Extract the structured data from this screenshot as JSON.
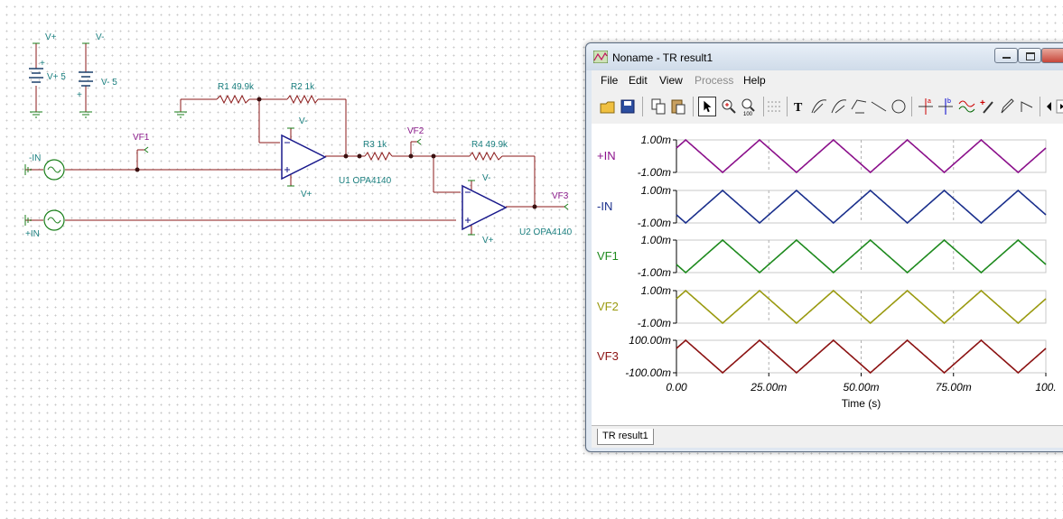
{
  "schematic": {
    "supply_pos": {
      "node": "V+",
      "name": "V+ 5"
    },
    "supply_neg": {
      "node": "V-",
      "name": "V- 5"
    },
    "src_neg_in": "-IN",
    "src_pos_in": "+IN",
    "r1": "R1 49.9k",
    "r2": "R2 1k",
    "r3": "R3 1k",
    "r4": "R4 49.9k",
    "u1": "U1 OPA4140",
    "u2": "U2 OPA4140",
    "u1_vneg": "V-",
    "u1_vpos": "V+",
    "u2_vneg": "V-",
    "u2_vpos": "V+",
    "vf1": "VF1",
    "vf2": "VF2",
    "vf3": "VF3"
  },
  "window": {
    "title": "Noname - TR result1",
    "menu": [
      "File",
      "Edit",
      "View",
      "Process",
      "Help"
    ],
    "menu_disabled": "Process",
    "status_tab": "TR result1",
    "toolbar_icons": [
      "open-icon",
      "save-icon",
      "copy-icon",
      "paste-icon",
      "pointer-icon",
      "zoom-in-icon",
      "zoom-100-icon",
      "grid-icon",
      "text-icon",
      "curve-tool-icon",
      "curve-tool-2-icon",
      "curve-tool-3-icon",
      "line-icon",
      "circle-icon",
      "cursor-a-icon",
      "cursor-b-icon",
      "waveform-icon",
      "probe-icon",
      "pen-icon",
      "left-arrow-icon"
    ]
  },
  "chart_data": {
    "type": "line",
    "xlabel": "Time (s)",
    "x_ticks": [
      "0.00",
      "25.00m",
      "50.00m",
      "75.00m",
      "100."
    ],
    "xlim": [
      0,
      0.1
    ],
    "grid": true,
    "series": [
      {
        "name": "+IN",
        "color": "#8b108b",
        "ymax_label": "1.00m",
        "ymin_label": "-1.00m",
        "ylim": [
          -0.001,
          0.001
        ],
        "period": 0.02,
        "peak_t": 0.0025
      },
      {
        "name": "-IN",
        "color": "#1a2f8c",
        "ymax_label": "1.00m",
        "ymin_label": "-1.00m",
        "ylim": [
          -0.001,
          0.001
        ],
        "period": 0.02,
        "peak_t": 0.0125
      },
      {
        "name": "VF1",
        "color": "#1e8a1e",
        "ymax_label": "1.00m",
        "ymin_label": "-1.00m",
        "ylim": [
          -0.001,
          0.001
        ],
        "period": 0.02,
        "peak_t": 0.0125
      },
      {
        "name": "VF2",
        "color": "#9a9a10",
        "ymax_label": "1.00m",
        "ymin_label": "-1.00m",
        "ylim": [
          -0.001,
          0.001
        ],
        "period": 0.02,
        "peak_t": 0.0025
      },
      {
        "name": "VF3",
        "color": "#8b1212",
        "ymax_label": "100.00m",
        "ymin_label": "-100.00m",
        "ylim": [
          -0.1,
          0.1
        ],
        "period": 0.02,
        "peak_t": 0.0025
      }
    ]
  }
}
